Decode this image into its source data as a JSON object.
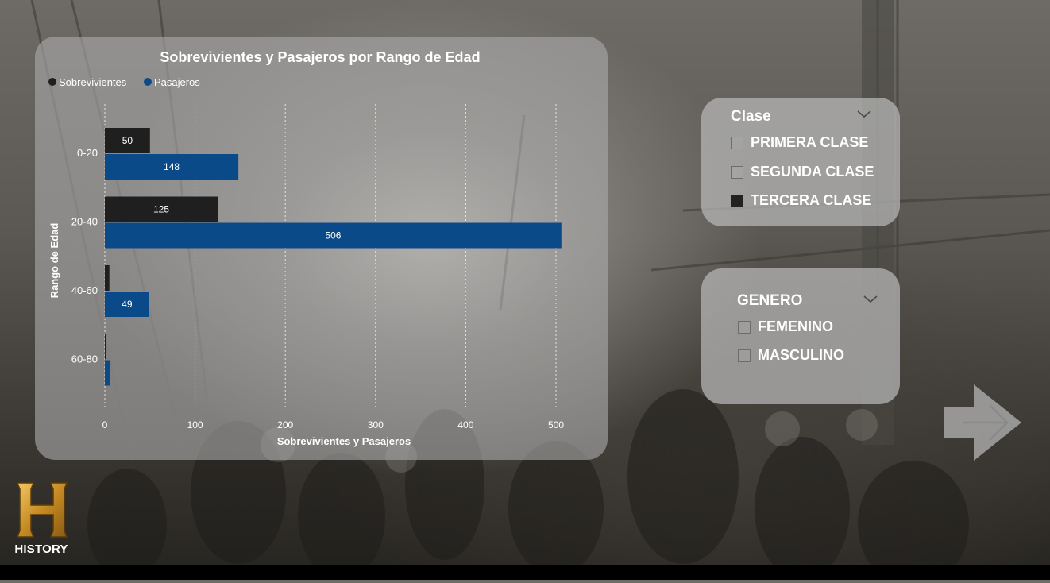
{
  "chart_data": {
    "type": "bar",
    "orientation": "horizontal",
    "title": "Sobrevivientes y Pasajeros por Rango de Edad",
    "xlabel": "Sobrevivientes y Pasajeros",
    "ylabel": "Rango de Edad",
    "categories": [
      "0-20",
      "20-40",
      "40-60",
      "60-80"
    ],
    "series": [
      {
        "name": "Sobrevivientes",
        "values": [
          50,
          125,
          5,
          1
        ],
        "labels": [
          "50",
          "125",
          "",
          ""
        ],
        "color": "#1f1f1f"
      },
      {
        "name": "Pasajeros",
        "values": [
          148,
          506,
          49,
          6
        ],
        "labels": [
          "148",
          "506",
          "49",
          ""
        ],
        "color": "#0b4a88"
      }
    ],
    "xlim": [
      0,
      510
    ],
    "xticks": [
      0,
      100,
      200,
      300,
      400,
      500
    ],
    "grid": "vertical-dotted",
    "legend": "top-left"
  },
  "slicers": {
    "clase": {
      "title": "Clase",
      "options": [
        {
          "label": "PRIMERA CLASE",
          "checked": false
        },
        {
          "label": "SEGUNDA CLASE",
          "checked": false
        },
        {
          "label": "TERCERA CLASE",
          "checked": true
        }
      ]
    },
    "genero": {
      "title": "GENERO",
      "options": [
        {
          "label": "FEMENINO",
          "checked": false
        },
        {
          "label": "MASCULINO",
          "checked": false
        }
      ]
    }
  },
  "logo": {
    "text": "HISTORY",
    "letter": "H"
  },
  "icons": {
    "next": "arrow-right-icon",
    "dropdown": "chevron-down-icon"
  }
}
